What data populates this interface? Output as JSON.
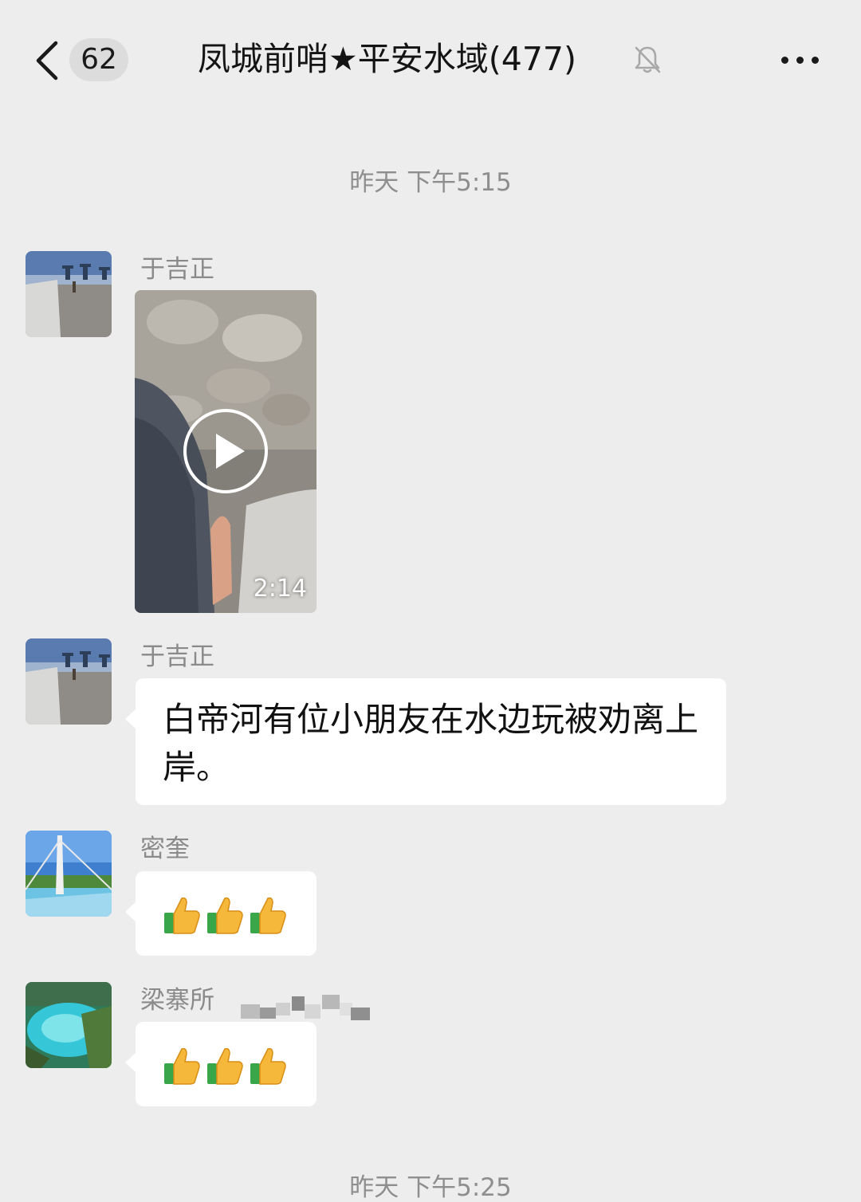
{
  "header": {
    "unread_count": "62",
    "chat_title": "凤城前哨★平安水域(477)"
  },
  "timestamps": {
    "first": "昨天 下午5:15",
    "second": "昨天 下午5:25"
  },
  "messages": [
    {
      "sender": "于吉正",
      "type": "video",
      "duration": "2:14"
    },
    {
      "sender": "于吉正",
      "type": "text",
      "text": "白帝河有位小朋友在水边玩被劝离上岸。"
    },
    {
      "sender": "密奎",
      "type": "emoji",
      "emoji": "thumbs-up x3"
    },
    {
      "sender": "梁寨所",
      "type": "emoji",
      "emoji": "thumbs-up x3"
    }
  ],
  "colors": {
    "background": "#ededed",
    "bubble": "#ffffff",
    "badge": "#dcdcdc",
    "secondary_text": "#8a8a8a"
  }
}
